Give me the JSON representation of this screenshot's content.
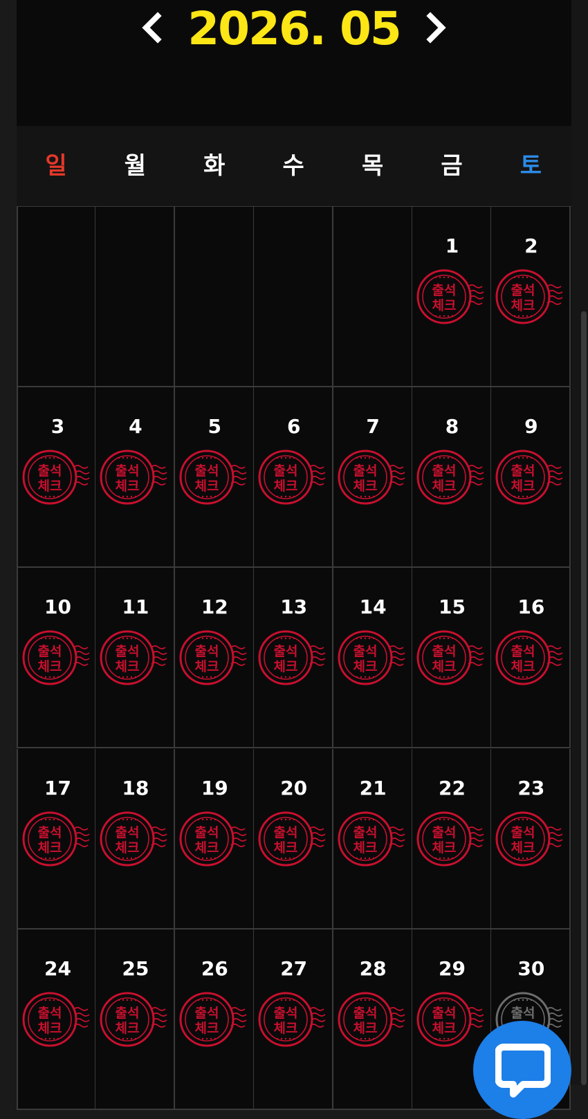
{
  "header": {
    "month_title": "2026. 05",
    "prev_icon": "chevron-left-icon",
    "next_icon": "chevron-right-icon",
    "title_color": "#fde616"
  },
  "weekdays": [
    {
      "label": "일",
      "color": "#e5392a"
    },
    {
      "label": "월",
      "color": "#ffffff"
    },
    {
      "label": "화",
      "color": "#ffffff"
    },
    {
      "label": "수",
      "color": "#ffffff"
    },
    {
      "label": "목",
      "color": "#ffffff"
    },
    {
      "label": "금",
      "color": "#ffffff"
    },
    {
      "label": "토",
      "color": "#2c8be8"
    }
  ],
  "calendar": {
    "leading_blank_days": 5,
    "days": [
      {
        "day": "1",
        "stamp": "checked"
      },
      {
        "day": "2",
        "stamp": "checked"
      },
      {
        "day": "3",
        "stamp": "checked"
      },
      {
        "day": "4",
        "stamp": "checked"
      },
      {
        "day": "5",
        "stamp": "checked"
      },
      {
        "day": "6",
        "stamp": "checked"
      },
      {
        "day": "7",
        "stamp": "checked"
      },
      {
        "day": "8",
        "stamp": "checked"
      },
      {
        "day": "9",
        "stamp": "checked"
      },
      {
        "day": "10",
        "stamp": "checked"
      },
      {
        "day": "11",
        "stamp": "checked"
      },
      {
        "day": "12",
        "stamp": "checked"
      },
      {
        "day": "13",
        "stamp": "checked"
      },
      {
        "day": "14",
        "stamp": "checked"
      },
      {
        "day": "15",
        "stamp": "checked"
      },
      {
        "day": "16",
        "stamp": "checked"
      },
      {
        "day": "17",
        "stamp": "checked"
      },
      {
        "day": "18",
        "stamp": "checked"
      },
      {
        "day": "19",
        "stamp": "checked"
      },
      {
        "day": "20",
        "stamp": "checked"
      },
      {
        "day": "21",
        "stamp": "checked"
      },
      {
        "day": "22",
        "stamp": "checked"
      },
      {
        "day": "23",
        "stamp": "checked"
      },
      {
        "day": "24",
        "stamp": "checked"
      },
      {
        "day": "25",
        "stamp": "checked"
      },
      {
        "day": "26",
        "stamp": "checked"
      },
      {
        "day": "27",
        "stamp": "checked"
      },
      {
        "day": "28",
        "stamp": "checked"
      },
      {
        "day": "29",
        "stamp": "checked"
      },
      {
        "day": "30",
        "stamp": "pending"
      }
    ]
  },
  "stamp": {
    "line1": "출석",
    "line2": "체크",
    "checked_color": "#c8102e",
    "pending_color": "#6e6e6e",
    "icon": "attendance-stamp-icon"
  },
  "chat": {
    "icon": "chat-bubble-icon",
    "color": "#1d7fe8"
  }
}
